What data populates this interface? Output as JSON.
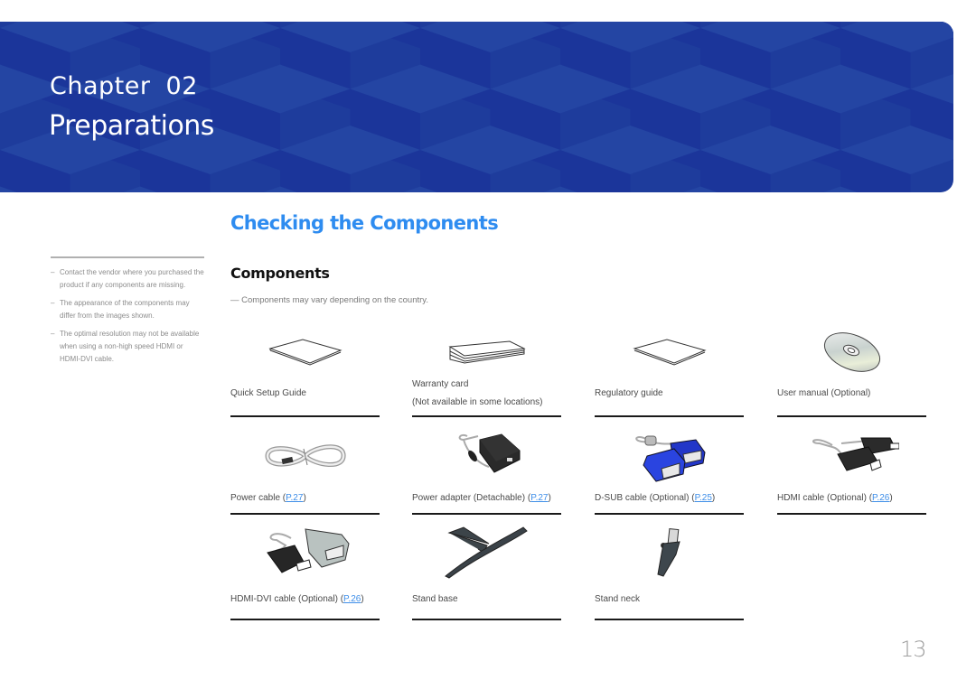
{
  "banner": {
    "chapter_label": "Chapter  02",
    "chapter_title": "Preparations",
    "color": "#1e3c9c"
  },
  "side_notes": [
    "Contact the vendor where you purchased the product if any components are missing.",
    "The appearance of the components may differ from the images shown.",
    "The optimal resolution may not be available when using a non-high speed HDMI or HDMI-DVI cable."
  ],
  "section": {
    "title": "Checking the Components",
    "title_color": "#2e8cf0",
    "subtitle": "Components",
    "note": "Components may vary depending on the country."
  },
  "components": [
    {
      "icon": "booklet-icon",
      "label": "Quick Setup Guide",
      "link": ""
    },
    {
      "icon": "card-icon",
      "label": "Warranty card",
      "label2": "(Not available in some locations)",
      "link": ""
    },
    {
      "icon": "booklet-icon",
      "label": "Regulatory guide",
      "link": ""
    },
    {
      "icon": "cd-icon",
      "label": "User manual (Optional)",
      "link": ""
    },
    {
      "icon": "power-cable-icon",
      "label": "Power cable (",
      "link": "P.27",
      "suffix": ")"
    },
    {
      "icon": "power-adapter-icon",
      "label": "Power adapter (Detachable) (",
      "link": "P.27",
      "suffix": ")"
    },
    {
      "icon": "dsub-cable-icon",
      "label": "D-SUB cable (Optional) (",
      "link": "P.25",
      "suffix": ")"
    },
    {
      "icon": "hdmi-cable-icon",
      "label": "HDMI cable (Optional) (",
      "link": "P.26",
      "suffix": ")"
    },
    {
      "icon": "hdmi-dvi-cable-icon",
      "label": "HDMI-DVI cable (Optional) (",
      "link": "P.26",
      "suffix": ")"
    },
    {
      "icon": "stand-base-icon",
      "label": "Stand base",
      "link": ""
    },
    {
      "icon": "stand-neck-icon",
      "label": "Stand neck",
      "link": ""
    }
  ],
  "page_number": "13",
  "note_dash": "―",
  "sub_note_dash": "―"
}
